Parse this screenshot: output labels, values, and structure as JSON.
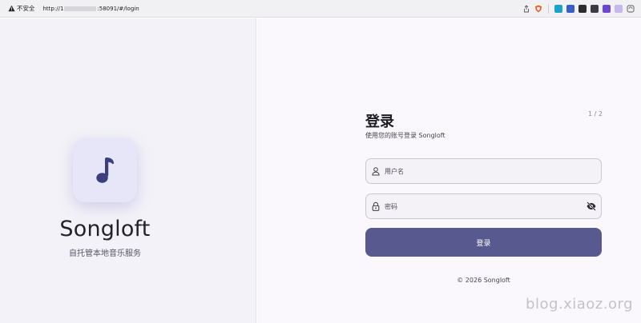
{
  "browser": {
    "insecure_label": "不安全",
    "url_prefix": "http://1",
    "url_suffix": ":58091/#/login",
    "toolbar_icons": [
      "share-icon",
      "brave-shield-icon",
      "extension-z-icon",
      "extension-translate-icon",
      "extension-icon",
      "extension-monitor-icon",
      "extension-purple-icon",
      "extension-lavender-icon",
      "extension-sync-icon"
    ]
  },
  "left": {
    "app_name": "Songloft",
    "app_subtitle": "自托管本地音乐服务",
    "app_icon": "music-note-icon",
    "accent_color": "#3e3e7e"
  },
  "login": {
    "title": "登录",
    "subtitle": "使用您的账号登录 Songloft",
    "page_indicator": "1 / 2",
    "username_placeholder": "用户名",
    "password_placeholder": "密码",
    "submit_label": "登录",
    "button_color": "#58598f"
  },
  "footer": {
    "copyright": "© 2026 Songloft"
  },
  "watermark": "blog.xiaoz.org"
}
